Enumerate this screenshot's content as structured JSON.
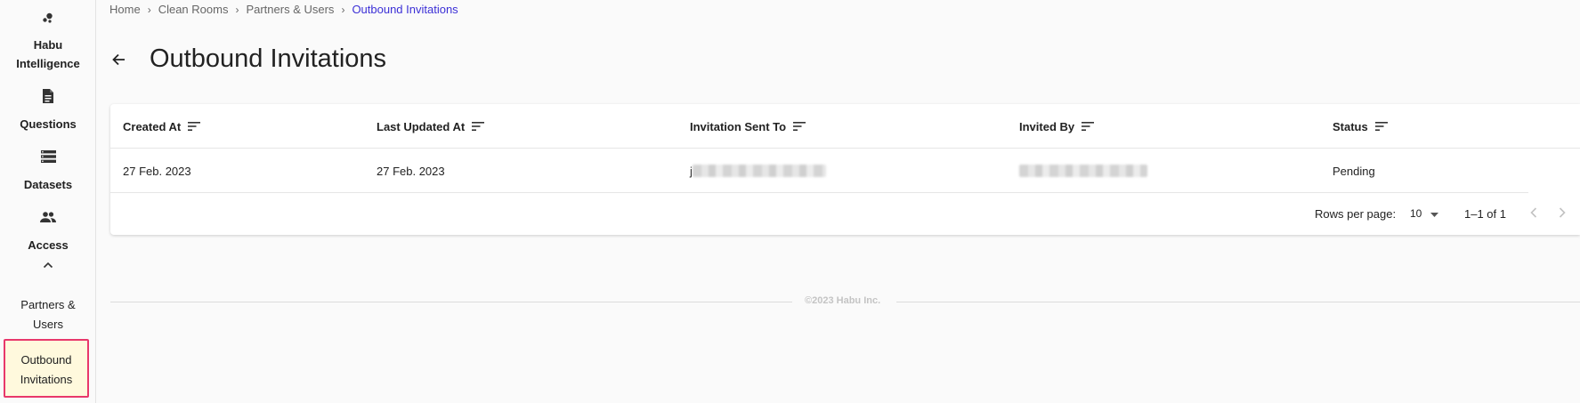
{
  "sidebar": {
    "brand": {
      "icon": "habu-logo-icon",
      "line1": "Habu",
      "line2": "Intelligence"
    },
    "items": [
      {
        "icon": "document-icon",
        "label": "Questions"
      },
      {
        "icon": "list-icon",
        "label": "Datasets"
      },
      {
        "icon": "people-icon",
        "label": "Access"
      }
    ],
    "access_toggle_icon": "chevron-up-icon",
    "sub_items": [
      {
        "line1": "Partners &",
        "line2": "Users"
      },
      {
        "line1": "Outbound",
        "line2": "Invitations",
        "active": true
      }
    ]
  },
  "breadcrumb": {
    "items": [
      "Home",
      "Clean Rooms",
      "Partners & Users"
    ],
    "current": "Outbound Invitations",
    "separator": "›"
  },
  "page": {
    "title": "Outbound Invitations",
    "back_icon": "arrow-left-icon"
  },
  "table": {
    "columns": [
      "Created At",
      "Last Updated At",
      "Invitation Sent To",
      "Invited By",
      "Status"
    ],
    "sort_icon": "sort-icon",
    "rows": [
      {
        "created_at": "27 Feb. 2023",
        "last_updated_at": "27 Feb. 2023",
        "invitation_sent_to": "j",
        "invited_by": "",
        "status": "Pending"
      }
    ]
  },
  "pagination": {
    "rows_per_page_label": "Rows per page:",
    "rows_per_page_value": "10",
    "range": "1–1 of 1"
  },
  "footer": {
    "text": "©2023 Habu Inc."
  },
  "colors": {
    "accent": "#3b2fd6",
    "active_bg": "#fff9dd",
    "active_border": "#e8386b"
  }
}
